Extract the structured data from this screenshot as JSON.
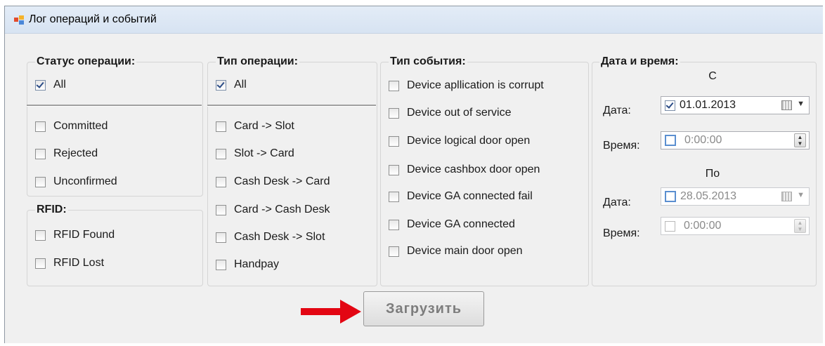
{
  "window": {
    "title": "Лог операций и событий"
  },
  "status_group": {
    "title": "Статус операции:",
    "all": {
      "label": "All",
      "checked": true
    },
    "items": [
      {
        "label": "Committed",
        "checked": false
      },
      {
        "label": "Rejected",
        "checked": false
      },
      {
        "label": "Unconfirmed",
        "checked": false
      }
    ]
  },
  "rfid_group": {
    "title": "RFID:",
    "items": [
      {
        "label": "RFID Found",
        "checked": false
      },
      {
        "label": "RFID Lost",
        "checked": false
      }
    ]
  },
  "op_type_group": {
    "title": "Тип операции:",
    "all": {
      "label": "All",
      "checked": true
    },
    "items": [
      {
        "label": "Card -> Slot",
        "checked": false
      },
      {
        "label": "Slot -> Card",
        "checked": false
      },
      {
        "label": "Cash Desk -> Card",
        "checked": false
      },
      {
        "label": "Card -> Cash Desk",
        "checked": false
      },
      {
        "label": "Cash Desk -> Slot",
        "checked": false
      },
      {
        "label": "Handpay",
        "checked": false
      }
    ]
  },
  "event_type_group": {
    "title": "Тип события:",
    "items": [
      {
        "label": "Device apllication is corrupt",
        "checked": false
      },
      {
        "label": "Device out of service",
        "checked": false
      },
      {
        "label": "Device logical door open",
        "checked": false
      },
      {
        "label": "Device cashbox door open",
        "checked": false
      },
      {
        "label": "Device GA connected fail",
        "checked": false
      },
      {
        "label": "Device GA connected",
        "checked": false
      },
      {
        "label": "Device main door open",
        "checked": false
      }
    ]
  },
  "datetime_group": {
    "title": "Дата и время:",
    "from_label": "С",
    "to_label": "По",
    "from": {
      "date_label": "Дата:",
      "date_value": "01.01.2013",
      "date_checked": true,
      "time_label": "Время:",
      "time_value": "0:00:00",
      "time_checked": false
    },
    "to": {
      "date_label": "Дата:",
      "date_value": "28.05.2013",
      "date_checked": false,
      "time_label": "Время:",
      "time_value": "0:00:00",
      "time_checked": false
    }
  },
  "actions": {
    "load_label": "Загрузить"
  },
  "colors": {
    "arrow": "#e30613",
    "titlebar": "#dce7f5",
    "panel": "#f0f0f0"
  }
}
